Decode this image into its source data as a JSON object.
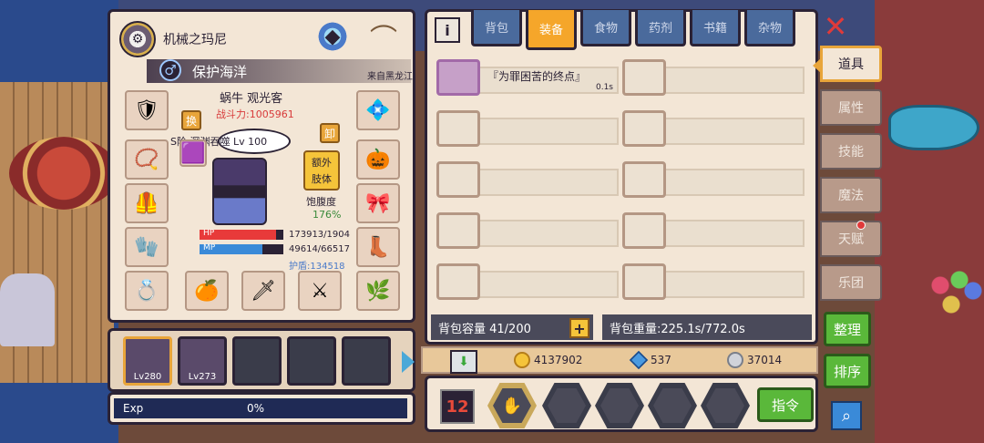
{
  "character": {
    "name": "机械之玛尼",
    "title": "保护海洋",
    "title_origin": "来自黑龙江",
    "pet_name": "蜗牛 观光客",
    "power": "战斗力:1005961",
    "weapon": "S阶 深渊吞噬 Lv 100",
    "swap_label": "换",
    "unequip_label": "卸",
    "extra_label_1": "额外",
    "extra_label_2": "肢体",
    "hunger_label": "饱腹度",
    "hunger_value": "176%",
    "hp_label": "HP",
    "hp_value": "173913/1904",
    "hp_ratio": 0.91,
    "mp_label": "MP",
    "mp_value": "49614/66517",
    "mp_ratio": 0.75,
    "shield": "护盾:134518"
  },
  "bag_bar": {
    "slots": [
      {
        "level": "Lv280",
        "filled": true,
        "selected": true
      },
      {
        "level": "Lv273",
        "filled": true,
        "selected": false
      },
      {
        "level": "",
        "filled": false,
        "selected": false
      },
      {
        "level": "",
        "filled": false,
        "selected": false
      },
      {
        "level": "",
        "filled": false,
        "selected": false
      }
    ]
  },
  "exp": {
    "label": "Exp",
    "value": "0%"
  },
  "tabs": [
    "背包",
    "装备",
    "食物",
    "药剂",
    "书籍",
    "杂物"
  ],
  "active_tab": "装备",
  "items": [
    {
      "name": "『为罪困苦的终点』",
      "weight": "0.1s"
    }
  ],
  "capacity": "背包容量 41/200",
  "weight": "背包重量:225.1s/772.0s",
  "currency": {
    "gold": "4137902",
    "gem": "537",
    "silver": "37014"
  },
  "command_label": "指令",
  "side_menu": {
    "items": [
      "道具",
      "属性",
      "技能",
      "魔法",
      "天赋",
      "乐团"
    ],
    "active": "道具"
  },
  "organize_label": "整理",
  "sort_label": "排序",
  "num_btn_label": "12"
}
